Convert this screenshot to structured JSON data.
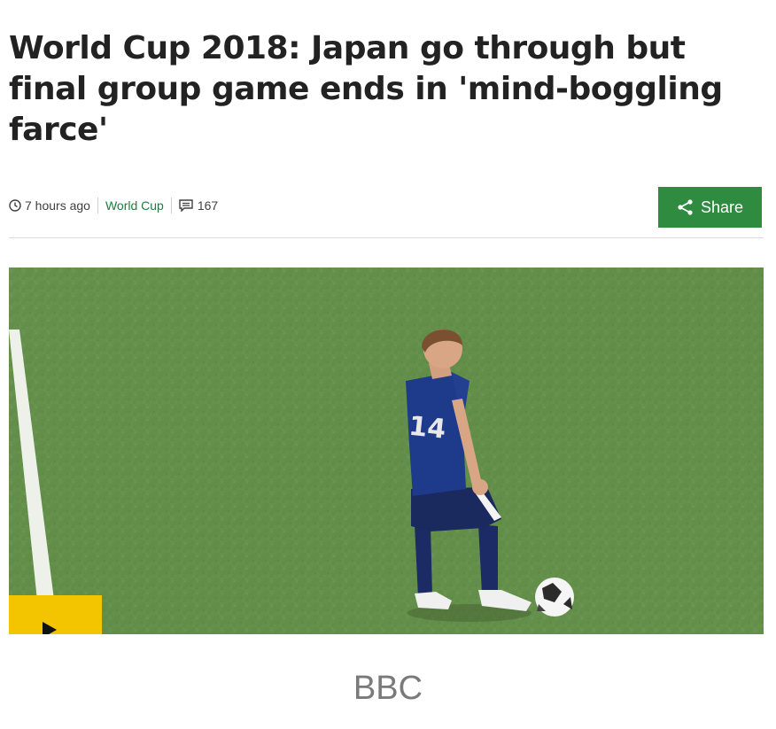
{
  "article": {
    "headline": "World Cup 2018: Japan go through but final group game ends in 'mind-boggling farce'",
    "meta": {
      "time": "7 hours ago",
      "topic": "World Cup",
      "comments": "167"
    },
    "share_label": "Share",
    "media": {
      "player_jersey_number": "14"
    }
  },
  "footer": {
    "source": "BBC"
  },
  "icons": {
    "clock": "clock-icon",
    "comments": "comment-icon",
    "share": "share-icon",
    "play": "play-icon"
  },
  "colors": {
    "headline": "#222222",
    "topic_link": "#1e7c3e",
    "share_button": "#2e8b3f",
    "play_button": "#f2c500",
    "pitch": "#5e8a45"
  }
}
